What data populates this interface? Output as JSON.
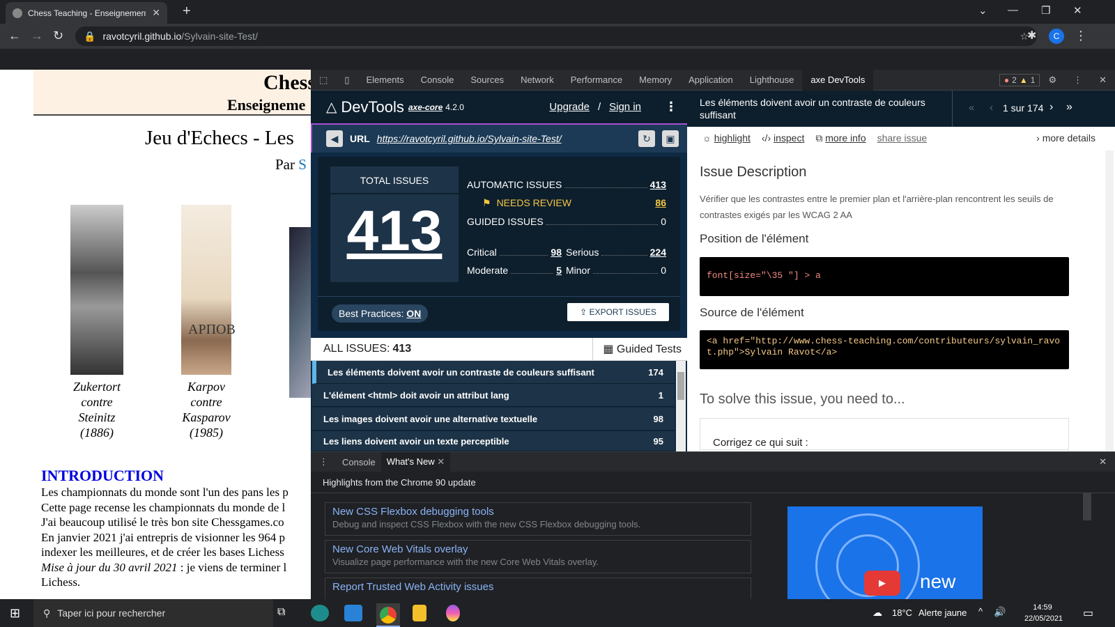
{
  "browser": {
    "tab_title": "Chess Teaching - Enseignement d",
    "url_host": "ravotcyril.github.io",
    "url_path": "/Sylvain-site-Test/",
    "profile_initial": "C"
  },
  "webpage": {
    "title": "Chess",
    "subtitle": "Enseigneme",
    "heading": "Jeu d'Echecs - Les",
    "by_prefix": "Par",
    "by_link": "S",
    "games": [
      {
        "caption": [
          "Zukertort",
          "contre",
          "Steinitz",
          "(1886)"
        ]
      },
      {
        "caption": [
          "Karpov",
          "contre",
          "Kasparov",
          "(1985)"
        ]
      }
    ],
    "intro_heading": "INTRODUCTION",
    "intro_lines": [
      "Les championnats du monde sont l'un des pans les p",
      "Cette page recense les championnats du monde de l",
      "J'ai beaucoup utilisé le très bon site Chessgames.co",
      "En janvier 2021 j'ai entrepris de visionner les 964 p",
      "indexer les meilleures, et de créer les bases Lichess",
      "Lichess."
    ],
    "intro_update_italic": "Mise à jour du 30 avril 2021",
    "intro_update_rest": " : je viens de terminer l"
  },
  "devtools": {
    "tabs": [
      "Elements",
      "Console",
      "Sources",
      "Network",
      "Performance",
      "Memory",
      "Application",
      "Lighthouse",
      "axe DevTools"
    ],
    "errors": "2",
    "warnings": "1"
  },
  "axe": {
    "brand": "DevTools",
    "engine": "axe-core",
    "version": "4.2.0",
    "upgrade": "Upgrade",
    "sep": "/",
    "signin": "Sign in",
    "url_label": "URL",
    "url": "https://ravotcyril.github.io/Sylvain-site-Test/",
    "total_label": "TOTAL ISSUES",
    "total": "413",
    "automatic_label": "AUTOMATIC ISSUES",
    "automatic": "413",
    "review_label": "NEEDS REVIEW",
    "review": "86",
    "guided_label": "GUIDED ISSUES",
    "guided": "0",
    "critical_label": "Critical",
    "critical": "98",
    "serious_label": "Serious",
    "serious": "224",
    "moderate_label": "Moderate",
    "moderate": "5",
    "minor_label": "Minor",
    "minor": "0",
    "best_label": "Best Practices:",
    "best_val": "ON",
    "export": "EXPORT ISSUES",
    "all_label": "ALL ISSUES:",
    "all_count": "413",
    "guided_tests": "Guided Tests",
    "issues": [
      {
        "label": "Les éléments doivent avoir un contraste de couleurs suffisant",
        "count": "174"
      },
      {
        "label": "L'élément <html> doit avoir un attribut lang",
        "count": "1"
      },
      {
        "label": "Les images doivent avoir une alternative textuelle",
        "count": "98"
      },
      {
        "label": "Les liens doivent avoir un texte perceptible",
        "count": "95"
      }
    ],
    "detail": {
      "title": "Les éléments doivent avoir un contraste de couleurs suffisant",
      "pager": "1 sur 174",
      "highlight": "highlight",
      "inspect": "inspect",
      "more_info": "more info",
      "share": "share issue",
      "more_details": "more details",
      "desc_h": "Issue Description",
      "desc": "Vérifier que les contrastes entre le premier plan et l'arrière-plan rencontrent les seuils de contrastes exigés par les WCAG 2 AA",
      "pos_h": "Position de l'élément",
      "pos_code": "font[size=\"\\35 \"] > a",
      "src_h": "Source de l'élément",
      "src_code": "<a href=\"http://www.chess-teaching.com/contributeurs/sylvain_ravot.php\">Sylvain Ravot</a>",
      "solve_h": "To solve this issue, you need to...",
      "solve_text": "Corrigez ce qui suit :"
    }
  },
  "drawer": {
    "tabs": [
      "Console",
      "What's New"
    ],
    "highlights": "Highlights from the Chrome 90 update",
    "items": [
      {
        "title": "New CSS Flexbox debugging tools",
        "desc": "Debug and inspect CSS Flexbox with the new CSS Flexbox debugging tools."
      },
      {
        "title": "New Core Web Vitals overlay",
        "desc": "Visualize page performance with the new Core Web Vitals overlay."
      },
      {
        "title": "Report Trusted Web Activity issues",
        "desc": ""
      }
    ],
    "promo": "new"
  },
  "taskbar": {
    "search": "Taper ici pour rechercher",
    "weather": "18°C",
    "alert": "Alerte jaune",
    "time": "14:59",
    "date": "22/05/2021"
  }
}
